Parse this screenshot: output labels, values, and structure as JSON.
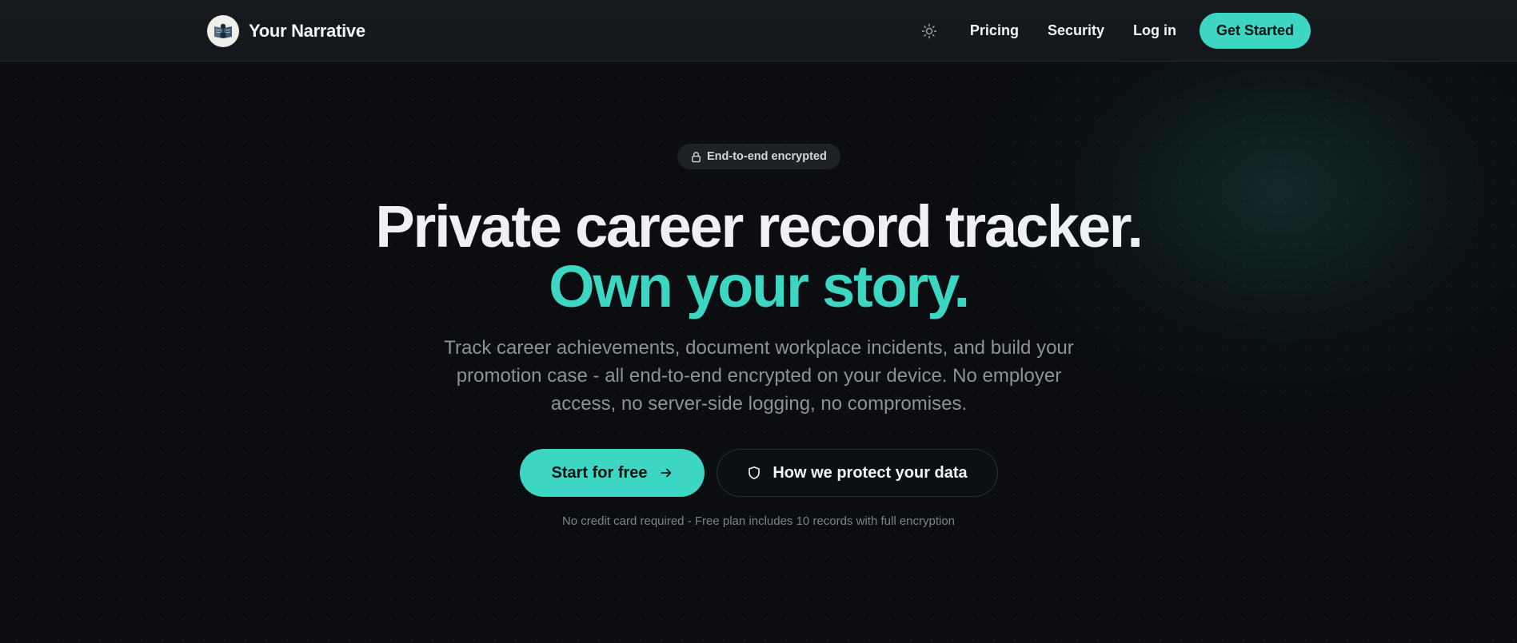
{
  "app": {
    "brand_name": "Your Narrative",
    "accent_color": "#3cd6c3",
    "background_color": "#0b0d10"
  },
  "header": {
    "theme_toggle_icon": "sun-icon",
    "nav": {
      "pricing": "Pricing",
      "security": "Security",
      "login": "Log in",
      "get_started": "Get Started"
    }
  },
  "hero": {
    "badge": {
      "icon": "lock-icon",
      "text": "End-to-end encrypted"
    },
    "title_line1": "Private career record tracker.",
    "title_line2": "Own your story.",
    "subtitle": "Track career achievements, document workplace incidents, and build your promotion case - all end-to-end encrypted on your device. No employer access, no server-side logging, no compromises.",
    "cta_primary": {
      "label": "Start for free",
      "icon": "arrow-right-icon"
    },
    "cta_secondary": {
      "label": "How we protect your data",
      "icon": "shield-icon"
    },
    "footnote": "No credit card required - Free plan includes 10 records with full encryption"
  }
}
